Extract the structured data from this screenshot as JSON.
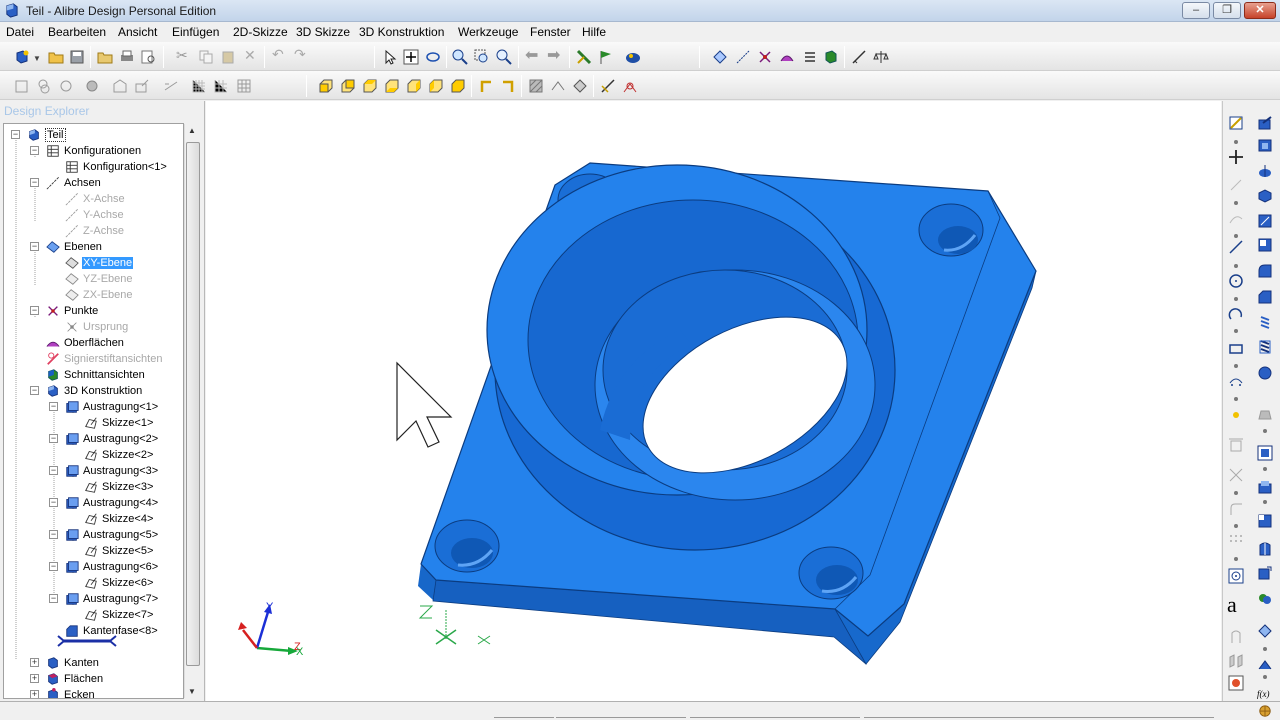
{
  "window": {
    "title": "Teil - Alibre Design Personal Edition",
    "buttons": {
      "minimize": "–",
      "maximize": "❐",
      "close": "✕"
    }
  },
  "menubar": [
    "Datei",
    "Bearbeiten",
    "Ansicht",
    "Einfügen",
    "2D-Skizze",
    "3D Skizze",
    "3D Konstruktion",
    "Werkzeuge",
    "Fenster",
    "Hilfe"
  ],
  "explorer": {
    "title": "Design Explorer",
    "tree": [
      {
        "label": "Teil",
        "icon": "part-icon",
        "state": "open"
      },
      {
        "label": "Konfigurationen",
        "icon": "config-icon",
        "state": "open"
      },
      {
        "label": "Konfiguration<1>",
        "icon": "config-icon"
      },
      {
        "label": "Achsen",
        "icon": "axis-icon",
        "state": "open"
      },
      {
        "label": "X-Achse",
        "icon": "axis-icon",
        "disabled": true
      },
      {
        "label": "Y-Achse",
        "icon": "axis-icon",
        "disabled": true
      },
      {
        "label": "Z-Achse",
        "icon": "axis-icon",
        "disabled": true
      },
      {
        "label": "Ebenen",
        "icon": "plane-icon",
        "state": "open"
      },
      {
        "label": "XY-Ebene",
        "icon": "plane-icon",
        "selected": true
      },
      {
        "label": "YZ-Ebene",
        "icon": "plane-icon",
        "disabled": true
      },
      {
        "label": "ZX-Ebene",
        "icon": "plane-icon",
        "disabled": true
      },
      {
        "label": "Punkte",
        "icon": "point-icon",
        "state": "open"
      },
      {
        "label": "Ursprung",
        "icon": "point-icon",
        "disabled": true
      },
      {
        "label": "Oberflächen",
        "icon": "surface-icon"
      },
      {
        "label": "Signierstiftansichten",
        "icon": "marker-icon",
        "disabled": true
      },
      {
        "label": "Schnittansichten",
        "icon": "section-icon"
      },
      {
        "label": "3D Konstruktion",
        "icon": "feature-icon",
        "state": "open"
      },
      {
        "label": "Austragung<1>",
        "icon": "extrude-icon",
        "state": "open"
      },
      {
        "label": "Skizze<1>",
        "icon": "sketch-icon"
      },
      {
        "label": "Austragung<2>",
        "icon": "extrude-icon",
        "state": "open"
      },
      {
        "label": "Skizze<2>",
        "icon": "sketch-icon"
      },
      {
        "label": "Austragung<3>",
        "icon": "extrude-icon",
        "state": "open"
      },
      {
        "label": "Skizze<3>",
        "icon": "sketch-icon"
      },
      {
        "label": "Austragung<4>",
        "icon": "extrude-icon",
        "state": "open"
      },
      {
        "label": "Skizze<4>",
        "icon": "sketch-icon"
      },
      {
        "label": "Austragung<5>",
        "icon": "extrude-icon",
        "state": "open"
      },
      {
        "label": "Skizze<5>",
        "icon": "sketch-icon"
      },
      {
        "label": "Austragung<6>",
        "icon": "extrude-icon",
        "state": "open"
      },
      {
        "label": "Skizze<6>",
        "icon": "sketch-icon"
      },
      {
        "label": "Austragung<7>",
        "icon": "extrude-icon",
        "state": "open"
      },
      {
        "label": "Skizze<7>",
        "icon": "sketch-icon"
      },
      {
        "label": "Kantenfase<8>",
        "icon": "chamfer-icon"
      },
      {
        "label": "",
        "icon": "rollback-bar-icon"
      },
      {
        "label": "Kanten",
        "icon": "edges-icon",
        "state": "closed"
      },
      {
        "label": "Flächen",
        "icon": "faces-icon",
        "state": "closed"
      },
      {
        "label": "Ecken",
        "icon": "vertices-icon",
        "state": "closed"
      }
    ]
  },
  "viewport": {
    "model_color": "#1e7ae6",
    "triad_labels": {
      "x": "X",
      "y": "Y",
      "z": "Z"
    }
  },
  "rightbar": {
    "text_tool": "a",
    "fx_label": "f(x)"
  },
  "colors": {
    "accent": "#3399ff",
    "part_blue": "#1e7ae6",
    "triad_green": "#16a83a",
    "triad_red": "#d62020",
    "triad_blue": "#1b2fd6"
  }
}
